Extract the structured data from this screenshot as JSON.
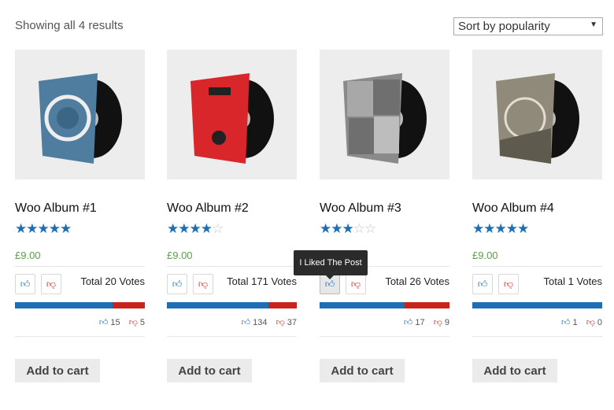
{
  "result_count": "Showing all 4 results",
  "sort": {
    "selected": "Sort by popularity",
    "arrow_icon": "caret-down-icon"
  },
  "tooltip": "I Liked The Post",
  "colors": {
    "accent": "#1e6eb5",
    "dislike": "#c9241c",
    "price": "#5b9e4a"
  },
  "products": [
    {
      "title": "Woo Album #1",
      "rating": 5,
      "price": "£9.00",
      "total": "Total 20 Votes",
      "likes": "15",
      "dislikes": "5",
      "like_share": 0.75,
      "cart": "Add to cart",
      "sleeve": "#4f7da0"
    },
    {
      "title": "Woo Album #2",
      "rating": 4,
      "price": "£9.00",
      "total": "Total 171 Votes",
      "likes": "134",
      "dislikes": "37",
      "like_share": 0.784,
      "cart": "Add to cart",
      "sleeve": "#d9262b"
    },
    {
      "title": "Woo Album #3",
      "rating": 3,
      "price": "£9.00",
      "total": "Total 26 Votes",
      "likes": "17",
      "dislikes": "9",
      "like_share": 0.654,
      "cart": "Add to cart",
      "sleeve": "#8a8a8a"
    },
    {
      "title": "Woo Album #4",
      "rating": 5,
      "price": "£9.00",
      "total": "Total 1 Votes",
      "likes": "1",
      "dislikes": "0",
      "like_share": 1.0,
      "cart": "Add to cart",
      "sleeve": "#8f8a7a"
    }
  ]
}
